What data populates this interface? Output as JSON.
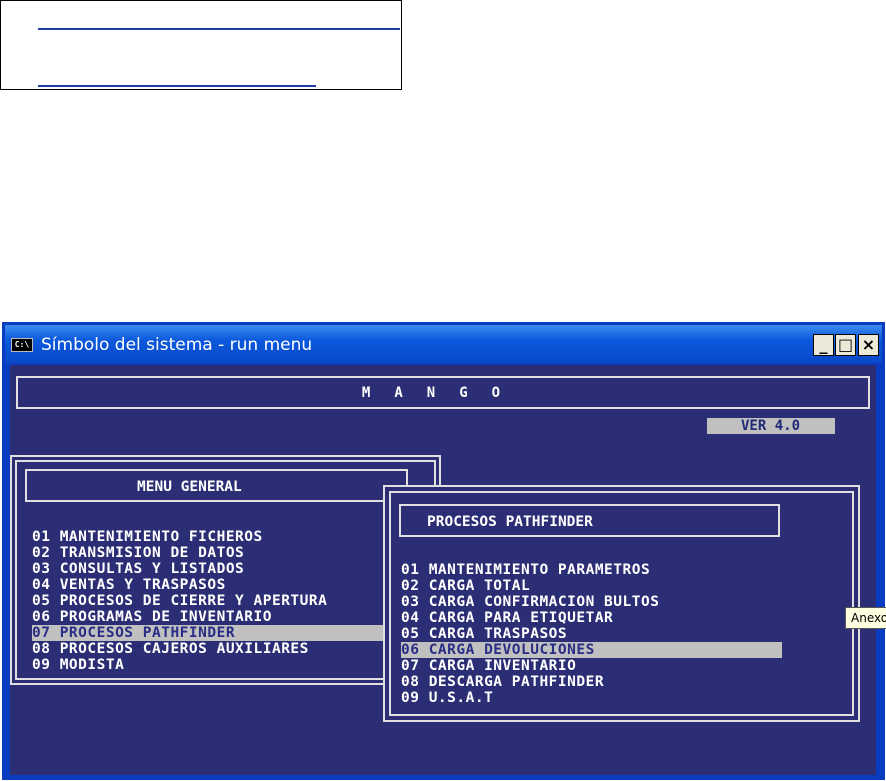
{
  "window": {
    "title": "Símbolo del sistema - run menu",
    "icon_text": "C:\\",
    "minimize": "_",
    "maximize": "□",
    "close": "×"
  },
  "header": {
    "brand": "MANGO",
    "version": "VER 4.0"
  },
  "menu_general": {
    "title": "MENU GENERAL",
    "items": [
      "01 MANTENIMIENTO FICHEROS",
      "02 TRANSMISION DE DATOS",
      "03 CONSULTAS Y LISTADOS",
      "04 VENTAS Y TRASPASOS",
      "05 PROCESOS DE CIERRE Y APERTURA",
      "06 PROGRAMAS DE INVENTARIO",
      "07 PROCESOS PATHFINDER",
      "08 PROCESOS CAJEROS AUXILIARES",
      "09 MODISTA"
    ],
    "selected_index": 6
  },
  "procesos_pathfinder": {
    "title": "PROCESOS PATHFINDER",
    "items": [
      "01 MANTENIMIENTO PARAMETROS",
      "02 CARGA TOTAL",
      "03 CARGA CONFIRMACION BULTOS",
      "04 CARGA PARA ETIQUETAR",
      "05 CARGA TRASPASOS",
      "06 CARGA DEVOLUCIONES",
      "07 CARGA INVENTARIO",
      "08 DESCARGA PATHFINDER",
      "09 U.S.A.T"
    ],
    "selected_index": 5
  },
  "tooltip": "Anexo",
  "colors": {
    "console_bg": "#2b2e74",
    "titlebar": "#0a49c8",
    "highlight": "#c0c0c0"
  }
}
